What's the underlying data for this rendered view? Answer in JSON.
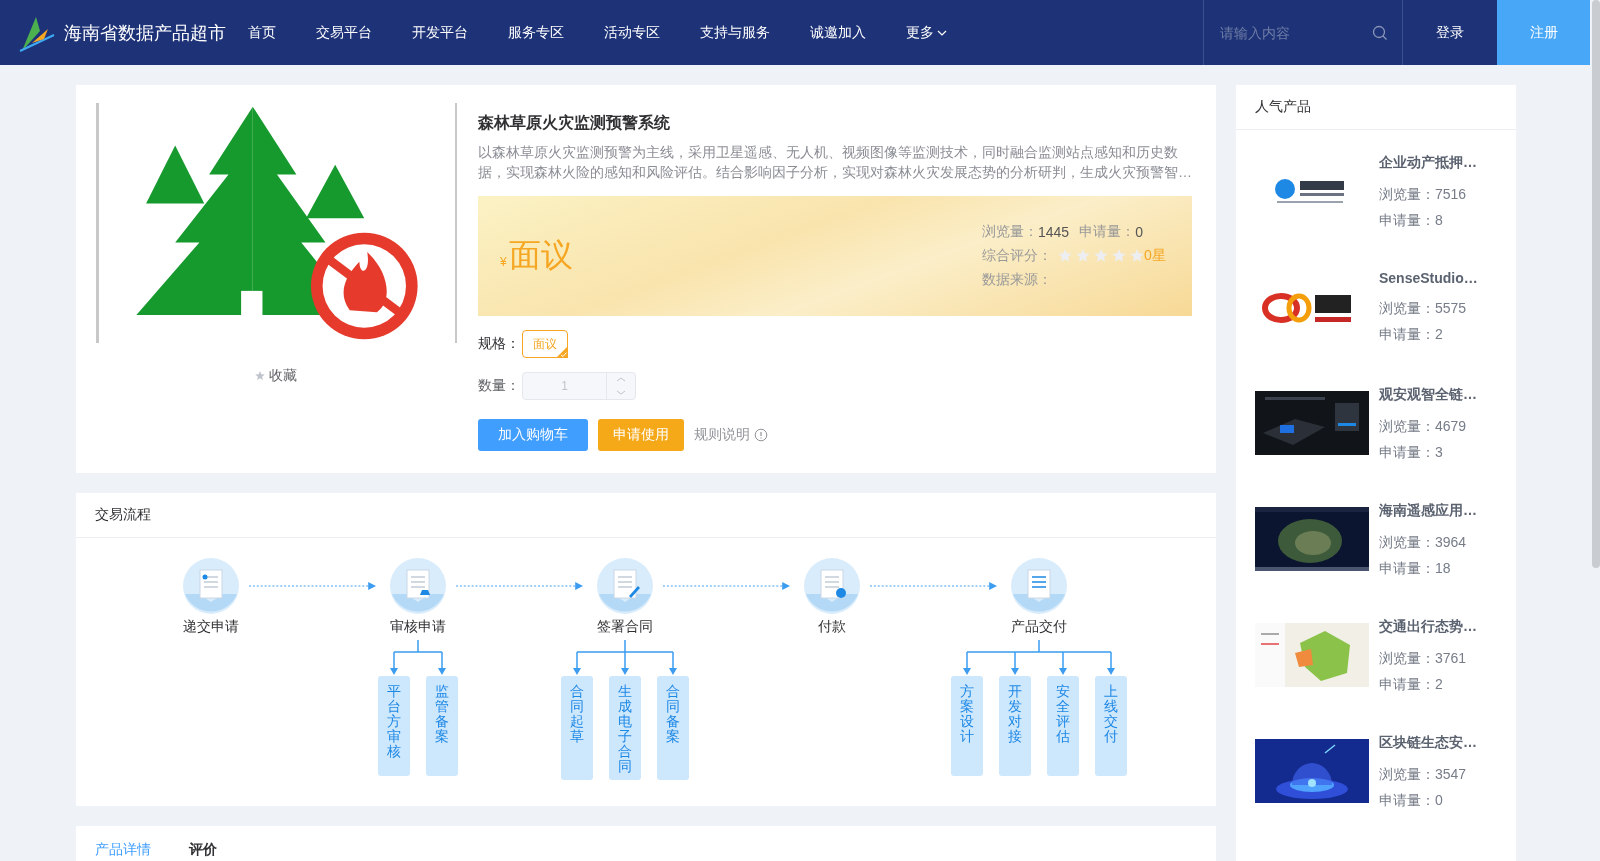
{
  "header": {
    "site_name": "海南省数据产品超市",
    "nav": [
      "首页",
      "交易平台",
      "开发平台",
      "服务专区",
      "活动专区",
      "支持与服务",
      "诚邀加入"
    ],
    "more": "更多",
    "search": {
      "placeholder": "请输入内容"
    },
    "login": "登录",
    "register": "注册"
  },
  "product": {
    "image": {
      "kind": "picture"
    },
    "favorite": "收藏",
    "title": "森林草原火灾监测预警系统",
    "description_lines": [
      "以森林草原火灾监测预警为主线，采用卫星遥感、无人机、视频图像等监测技术，同时融合监测站点感知和历史数",
      "据，实现森林火险的感知和风险评估。结合影响因子分析，实现对森林火灾发展态势的分析研判，生成火灾预警智…"
    ],
    "currency": "¥",
    "price": "面议",
    "views_label": "浏览量：",
    "views": "1445",
    "applies_label": "申请量：",
    "applies": "0",
    "rating_label": "综合评分：",
    "stars": 0,
    "rating_text": "0星",
    "source_label": "数据来源：",
    "spec_label": "规格：",
    "spec_options": [
      {
        "label": "面议",
        "selected": true
      }
    ],
    "quantity_label": "数量：",
    "quantity": "1",
    "add_to_cart": "加入购物车",
    "apply": "申请使用",
    "rules": "规则说明"
  },
  "flow": {
    "title": "交易流程",
    "steps": [
      {
        "label": "递交申请"
      },
      {
        "label": "审核申请",
        "substeps": [
          "平台方审核",
          "监管备案"
        ]
      },
      {
        "label": "签署合同",
        "substeps": [
          "合同起草",
          "生成电子合同",
          "合同备案"
        ]
      },
      {
        "label": "付款"
      },
      {
        "label": "产品交付",
        "substeps": [
          "方案设计",
          "开发对接",
          "安全评估",
          "上线交付"
        ]
      }
    ]
  },
  "tabs": [
    {
      "label": "产品详情",
      "selected": true
    },
    {
      "label": "评价",
      "selected": false
    }
  ],
  "popular": {
    "title": "人气产品",
    "items": [
      {
        "title": "企业动产抵押…",
        "views": "浏览量：7516",
        "applies": "申请量：8"
      },
      {
        "title": "SenseStudio…",
        "views": "浏览量：5575",
        "applies": "申请量：2"
      },
      {
        "title": "观安观智全链…",
        "views": "浏览量：4679",
        "applies": "申请量：3"
      },
      {
        "title": "海南遥感应用…",
        "views": "浏览量：3964",
        "applies": "申请量：18"
      },
      {
        "title": "交通出行态势…",
        "views": "浏览量：3761",
        "applies": "申请量：2"
      },
      {
        "title": "区块链生态安…",
        "views": "浏览量：3547",
        "applies": "申请量：0"
      }
    ]
  }
}
